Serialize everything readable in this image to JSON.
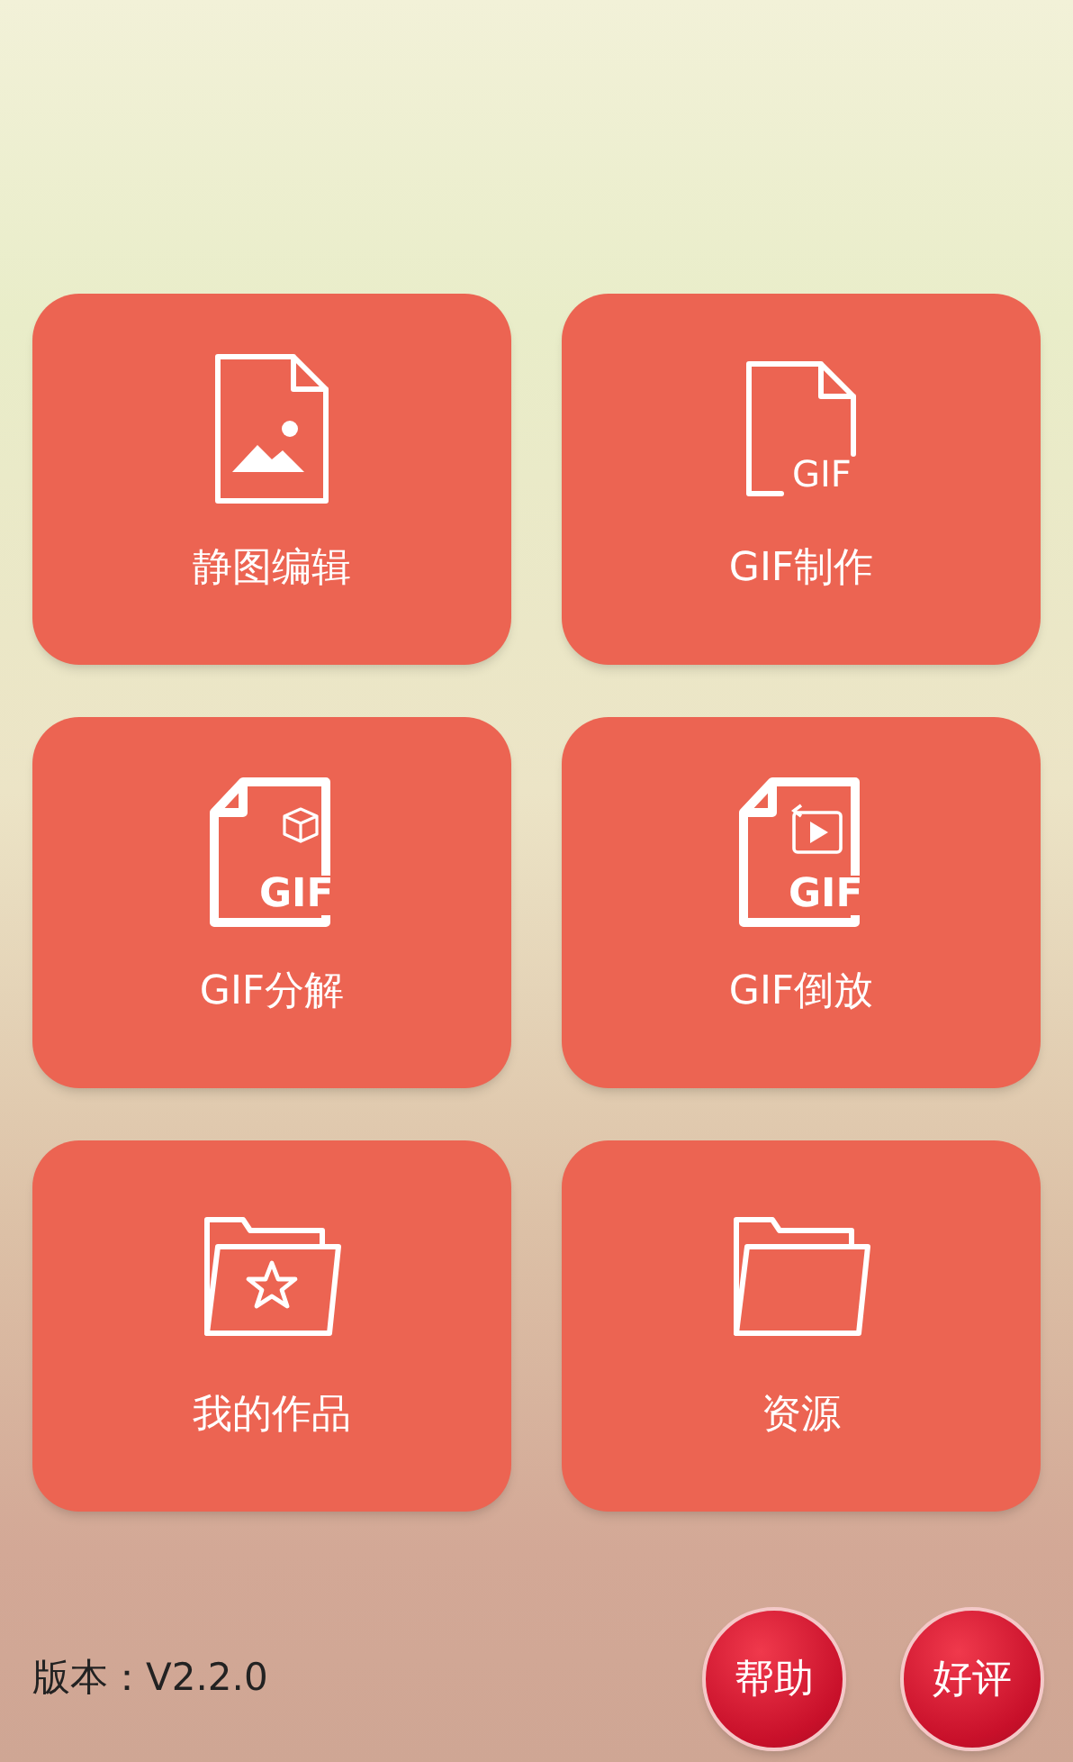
{
  "tile_rows": [
    {
      "tiles": [
        {
          "kind": "image",
          "label": "静图编辑"
        },
        {
          "kind": "gif",
          "label": "GIF制作",
          "icon_text": "GIF"
        }
      ]
    },
    {
      "tiles": [
        {
          "kind": "gif-split",
          "label": "GIF分解",
          "icon_text": "GIF"
        },
        {
          "kind": "gif-reverse",
          "label": "GIF倒放",
          "icon_text": "GIF"
        }
      ]
    },
    {
      "tiles": [
        {
          "kind": "folder-star",
          "label": "我的作品"
        },
        {
          "kind": "folder",
          "label": "资源"
        }
      ]
    }
  ],
  "version": "版本：V2.2.0",
  "buttons": [
    "帮助",
    "好评"
  ]
}
